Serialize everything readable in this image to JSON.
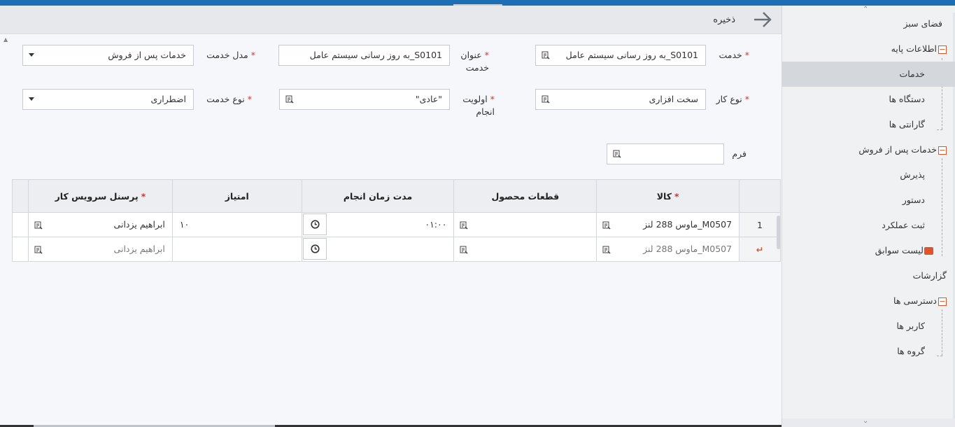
{
  "header": {
    "title": "ذخیره",
    "back_icon": "arrow-right-icon"
  },
  "sidebar": {
    "items": [
      {
        "label": "فضای سبز"
      },
      {
        "label": "اطلاعات پایه",
        "toggle": "−"
      },
      {
        "label": "خدمات"
      },
      {
        "label": "دستگاه ها"
      },
      {
        "label": "گارانتی ها"
      },
      {
        "label": "خدمات پس از فروش",
        "toggle": "−"
      },
      {
        "label": "پذیرش"
      },
      {
        "label": "دستور"
      },
      {
        "label": "ثبت عملکرد"
      },
      {
        "label": "لیست سوابق"
      },
      {
        "label": "گزارشات"
      },
      {
        "label": "دسترسی ها",
        "toggle": "−"
      },
      {
        "label": "کاربر ها"
      },
      {
        "label": "گروه ها"
      }
    ]
  },
  "form": {
    "service": {
      "label": "خدمت",
      "value": "S0101_به روز رسانی سیستم عامل"
    },
    "service_title": {
      "label1": "عنوان",
      "label2": "خدمت",
      "value": "S0101_به روز رسانی سیستم عامل"
    },
    "service_model": {
      "label": "مدل خدمت",
      "value": "خدمات پس از فروش"
    },
    "work_type": {
      "label": "نوع کار",
      "value": "سخت افزاری"
    },
    "priority": {
      "label1": "اولویت",
      "label2": "انجام",
      "value": "\"عادی\""
    },
    "service_type": {
      "label": "نوع خدمت",
      "value": "اضطراری"
    },
    "form_field": {
      "label": "فرم",
      "value": ""
    }
  },
  "grid": {
    "columns": [
      "کالا",
      "قطعات محصول",
      "مدت زمان انجام",
      "امتیاز",
      "پرسنل سرویس کار"
    ],
    "required": [
      true,
      false,
      false,
      false,
      true
    ],
    "rows": [
      {
        "index": "1",
        "item": "M0507_ماوس 288 لنز",
        "parts": "",
        "duration": "۰۱:۰۰",
        "score": "۱۰",
        "personnel": "ابراهیم یزدانی"
      },
      {
        "index": "↵",
        "item": "M0507_ماوس 288 لنز",
        "parts": "",
        "duration": "",
        "score": "",
        "personnel": "ابراهیم یزدانی"
      }
    ]
  },
  "colors": {
    "accent": "#1c6fb5",
    "required": "#d9302c",
    "tree_toggle": "#e0542b"
  }
}
